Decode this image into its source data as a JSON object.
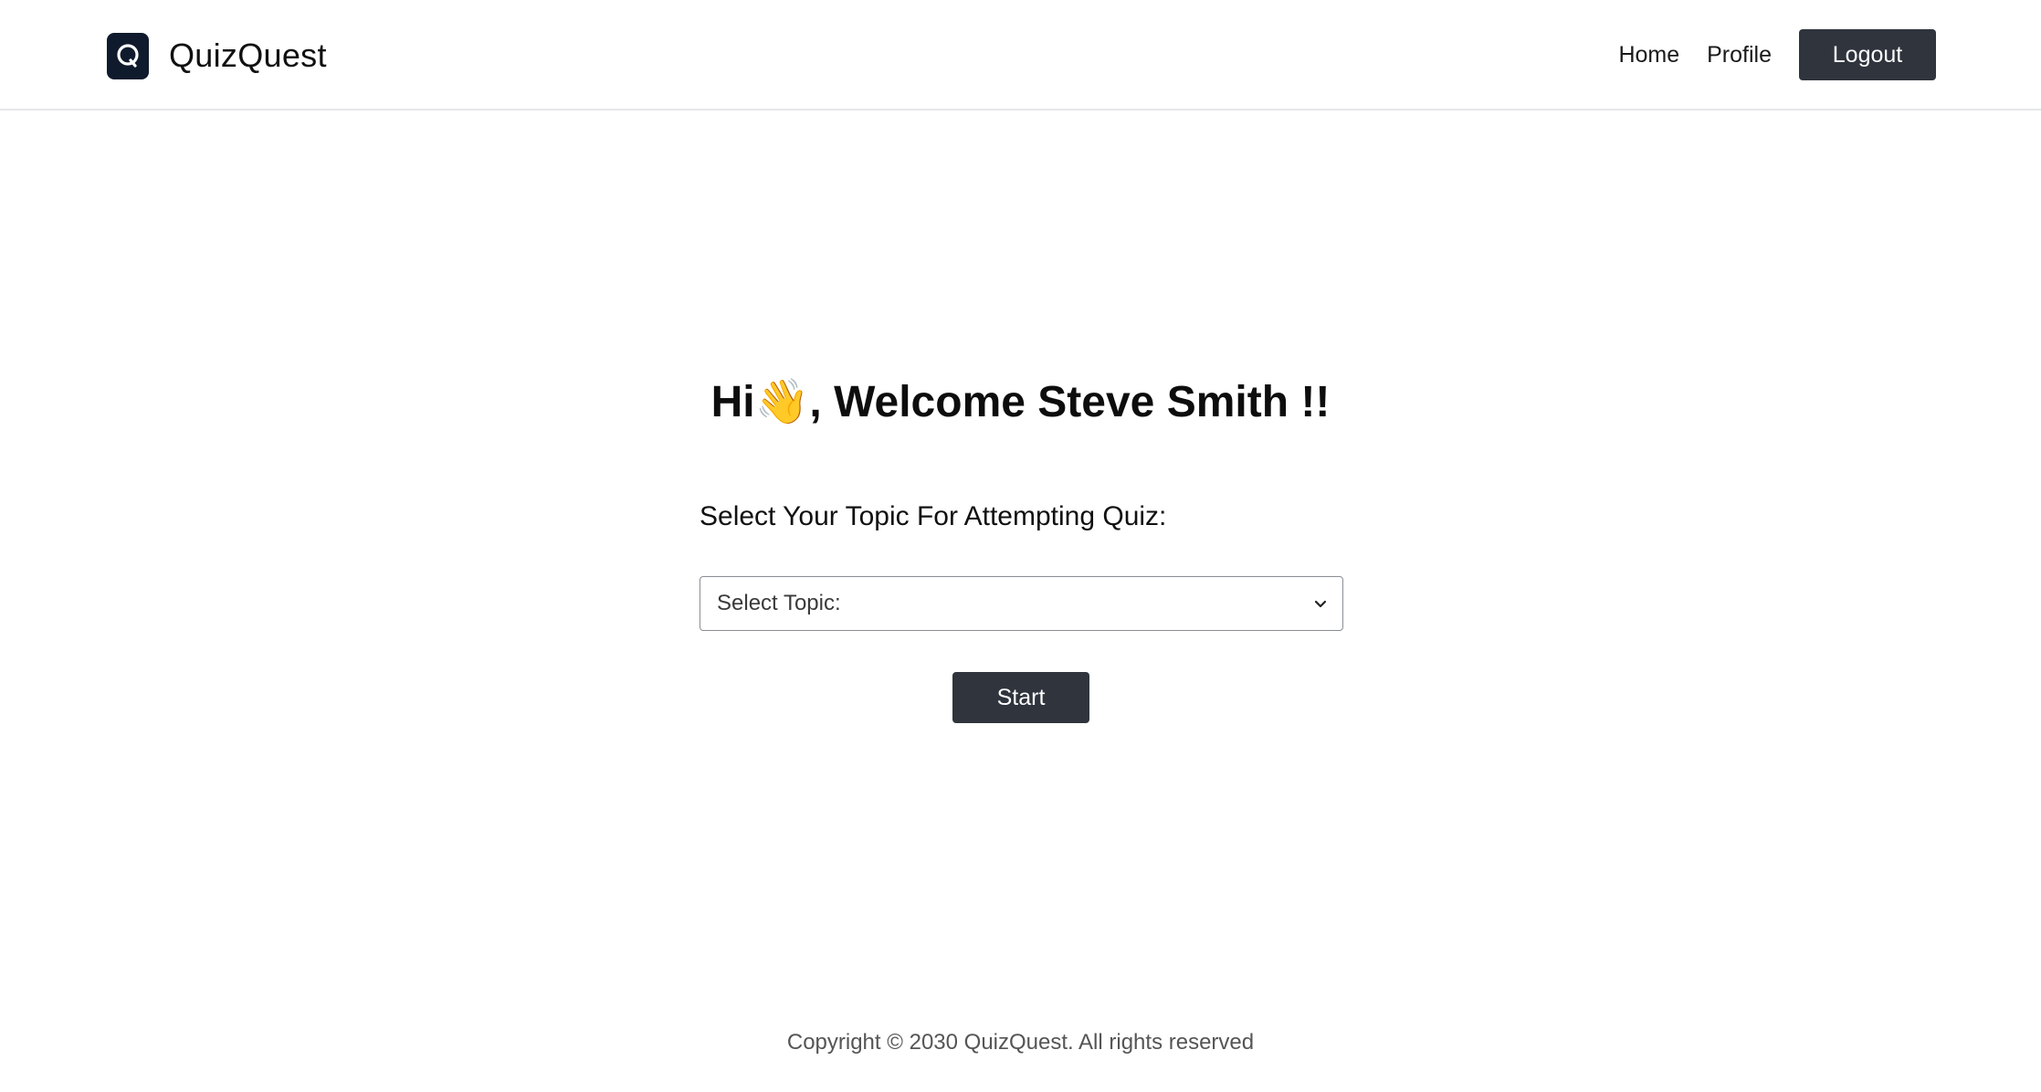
{
  "brand": {
    "name": "QuizQuest",
    "logo_icon": "quizquest-logo-icon"
  },
  "nav": {
    "home_label": "Home",
    "profile_label": "Profile",
    "logout_label": "Logout"
  },
  "main": {
    "greeting_prefix": "Hi",
    "greeting_emoji": "👋",
    "greeting_suffix": ", Welcome Steve Smith !!",
    "prompt": "Select Your Topic For Attempting Quiz:",
    "topic_select": {
      "selected_value": "Select Topic:",
      "icon": "chevron-down-icon"
    },
    "start_label": "Start"
  },
  "footer": {
    "copyright": "Copyright © 2030 QuizQuest. All rights reserved"
  },
  "colors": {
    "dark_button": "#2f343d",
    "logo_bg": "#0f1b2d",
    "header_border": "#e6e7ea"
  }
}
